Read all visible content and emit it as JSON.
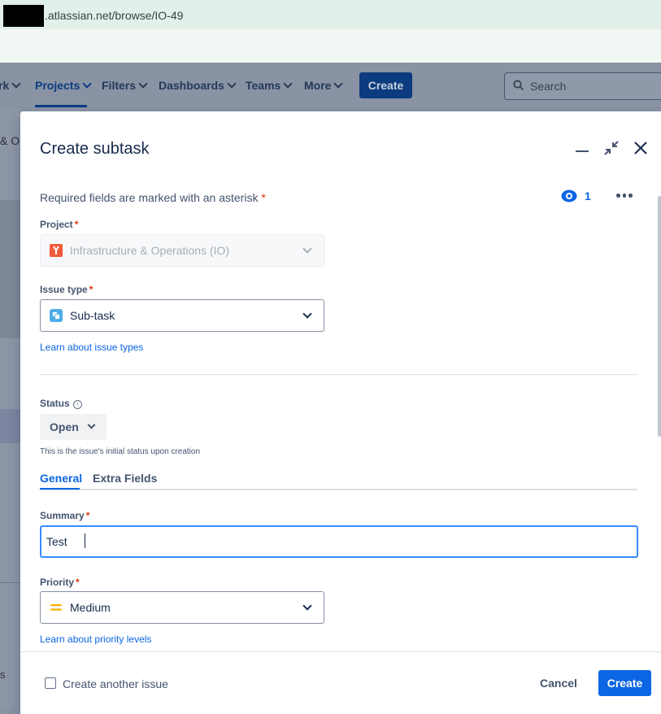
{
  "browser": {
    "url": ".atlassian.net/browse/IO-49"
  },
  "topnav": {
    "work_fragment": "rk",
    "items": [
      {
        "label": "Projects",
        "active": true
      },
      {
        "label": "Filters"
      },
      {
        "label": "Dashboards"
      },
      {
        "label": "Teams"
      },
      {
        "label": "More"
      }
    ],
    "create_label": "Create",
    "search_placeholder": "Search"
  },
  "background": {
    "fragment_top": "& Op",
    "fragment_bottom": "s"
  },
  "modal": {
    "title": "Create subtask",
    "required_note": "Required fields are marked with an asterisk",
    "required_star": "*",
    "watchers_count": "1",
    "project": {
      "label": "Project",
      "value": "Infrastructure & Operations (IO)",
      "disabled": true
    },
    "issue_type": {
      "label": "Issue type",
      "value": "Sub-task",
      "help_link": "Learn about issue types"
    },
    "status": {
      "label": "Status",
      "value": "Open",
      "hint": "This is the issue's initial status upon creation"
    },
    "tabs": [
      {
        "label": "General",
        "active": true
      },
      {
        "label": "Extra Fields"
      }
    ],
    "summary": {
      "label": "Summary",
      "value": "Test"
    },
    "priority": {
      "label": "Priority",
      "value": "Medium",
      "help_link": "Learn about priority levels"
    },
    "footer": {
      "create_another_label": "Create another issue",
      "create_another_checked": false,
      "cancel_label": "Cancel",
      "create_label": "Create"
    }
  },
  "colors": {
    "primary": "#0c66e4",
    "required": "#de350b",
    "overlay_bg": "#8993a4"
  }
}
